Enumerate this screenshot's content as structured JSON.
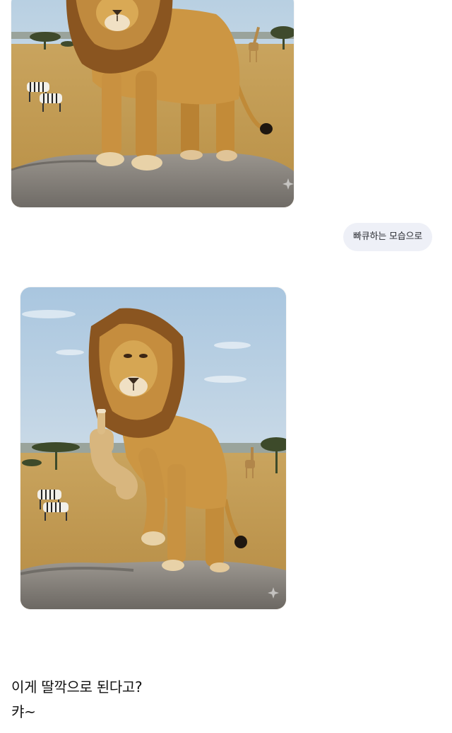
{
  "chat": {
    "user_message": "빠큐하는 모습으로",
    "image_1": {
      "alt": "lion-standing-on-rock"
    },
    "image_2": {
      "alt": "lion-middle-finger-on-rock"
    }
  },
  "caption": {
    "line1": "이게 딸깍으로 된다고?",
    "line2": "캬~"
  },
  "colors": {
    "background": "#ffffff",
    "bubble": "#eef0f7",
    "savanna": "#c9a25a",
    "sky": "#c9dcea",
    "lion_body": "#c78f3a",
    "mane": "#7a4a18",
    "rock": "#8a8680"
  }
}
